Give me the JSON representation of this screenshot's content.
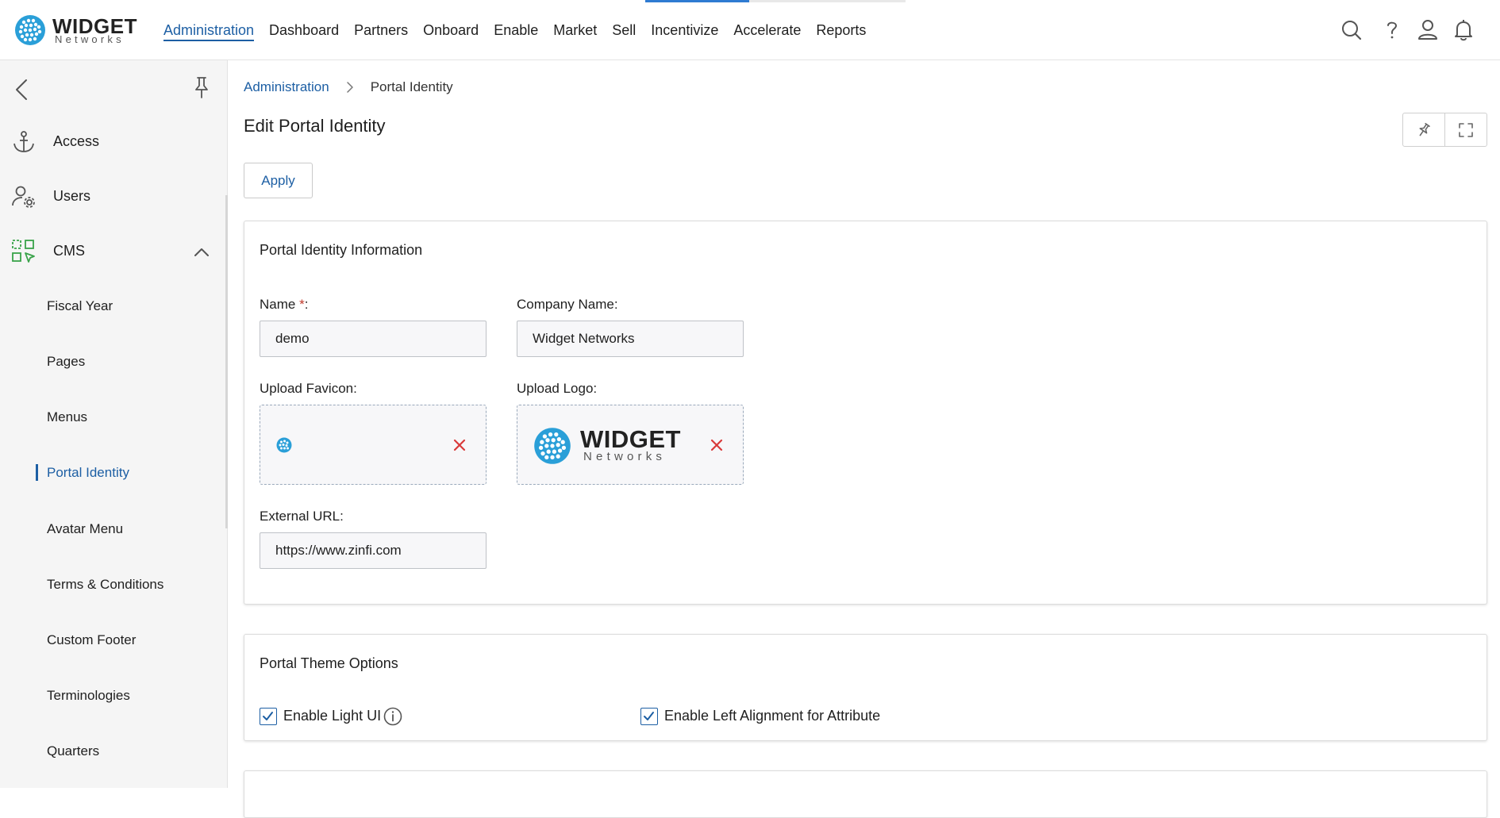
{
  "brand": {
    "name": "WIDGET",
    "sub": "Networks",
    "logo_color": "#2a9fd8"
  },
  "top_progress": {
    "fraction": 0.4
  },
  "nav": {
    "items": [
      "Administration",
      "Dashboard",
      "Partners",
      "Onboard",
      "Enable",
      "Market",
      "Sell",
      "Incentivize",
      "Accelerate",
      "Reports"
    ],
    "active_index": 0
  },
  "top_icons": [
    "search-icon",
    "help-icon",
    "user-icon",
    "bell-icon"
  ],
  "sidebar": {
    "items": [
      {
        "label": "Access",
        "icon": "anchor-icon"
      },
      {
        "label": "Users",
        "icon": "user-gear-icon"
      },
      {
        "label": "CMS",
        "icon": "cms-icon",
        "expanded": true
      }
    ],
    "sub_items": [
      "Fiscal Year",
      "Pages",
      "Menus",
      "Portal Identity",
      "Avatar Menu",
      "Terms & Conditions",
      "Custom Footer",
      "Terminologies",
      "Quarters"
    ],
    "active_sub": "Portal Identity"
  },
  "breadcrumb": {
    "parent": "Administration",
    "current": "Portal Identity"
  },
  "page": {
    "title": "Edit Portal Identity",
    "apply_label": "Apply"
  },
  "identity": {
    "title": "Portal Identity Information",
    "name_label": "Name",
    "required_mark": "*",
    "label_suffix": ":",
    "name_value": "demo",
    "company_label": "Company Name:",
    "company_value": "Widget Networks",
    "favicon_label": "Upload Favicon:",
    "logo_label": "Upload Logo:",
    "logo_preview": {
      "name": "WIDGET",
      "sub": "Networks"
    },
    "external_label": "External URL:",
    "external_value": "https://www.zinfi.com"
  },
  "theme": {
    "title": "Portal Theme Options",
    "light_ui_label": "Enable Light UI",
    "light_ui_checked": true,
    "left_align_label": "Enable Left Alignment for Attribute",
    "left_align_checked": true
  },
  "colors": {
    "accent": "#1d5fa4",
    "danger": "#d93a3a",
    "cms_icon": "#3aa34a"
  }
}
